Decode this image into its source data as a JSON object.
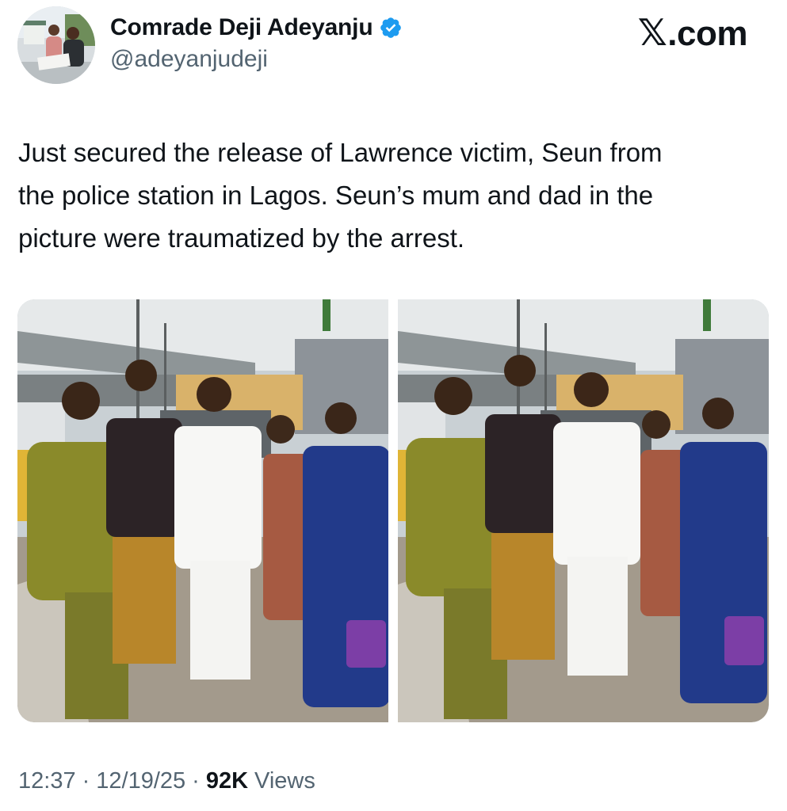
{
  "author": {
    "display_name": "Comrade Deji Adeyanju",
    "handle": "@adeyanjudeji",
    "verified_badge_icon": "verified-check-icon",
    "verified_color": "#1d9bf0"
  },
  "brand": {
    "label": ".com",
    "mark_icon": "x-logo-icon"
  },
  "tweet": {
    "text": "Just secured the release of Lawrence victim, Seun from\nthe police station in Lagos. Seun’s mum and dad in the\npicture were traumatized by the arrest."
  },
  "media": {
    "photos": [
      {
        "description_icon": "photo-group-icon"
      },
      {
        "description_icon": "photo-group-icon"
      }
    ]
  },
  "meta": {
    "time": "12:37",
    "separator": "·",
    "date": "12/19/25",
    "views_count": "92K",
    "views_label": "Views"
  },
  "colors": {
    "text_primary": "#0f1419",
    "text_secondary": "#536471"
  }
}
